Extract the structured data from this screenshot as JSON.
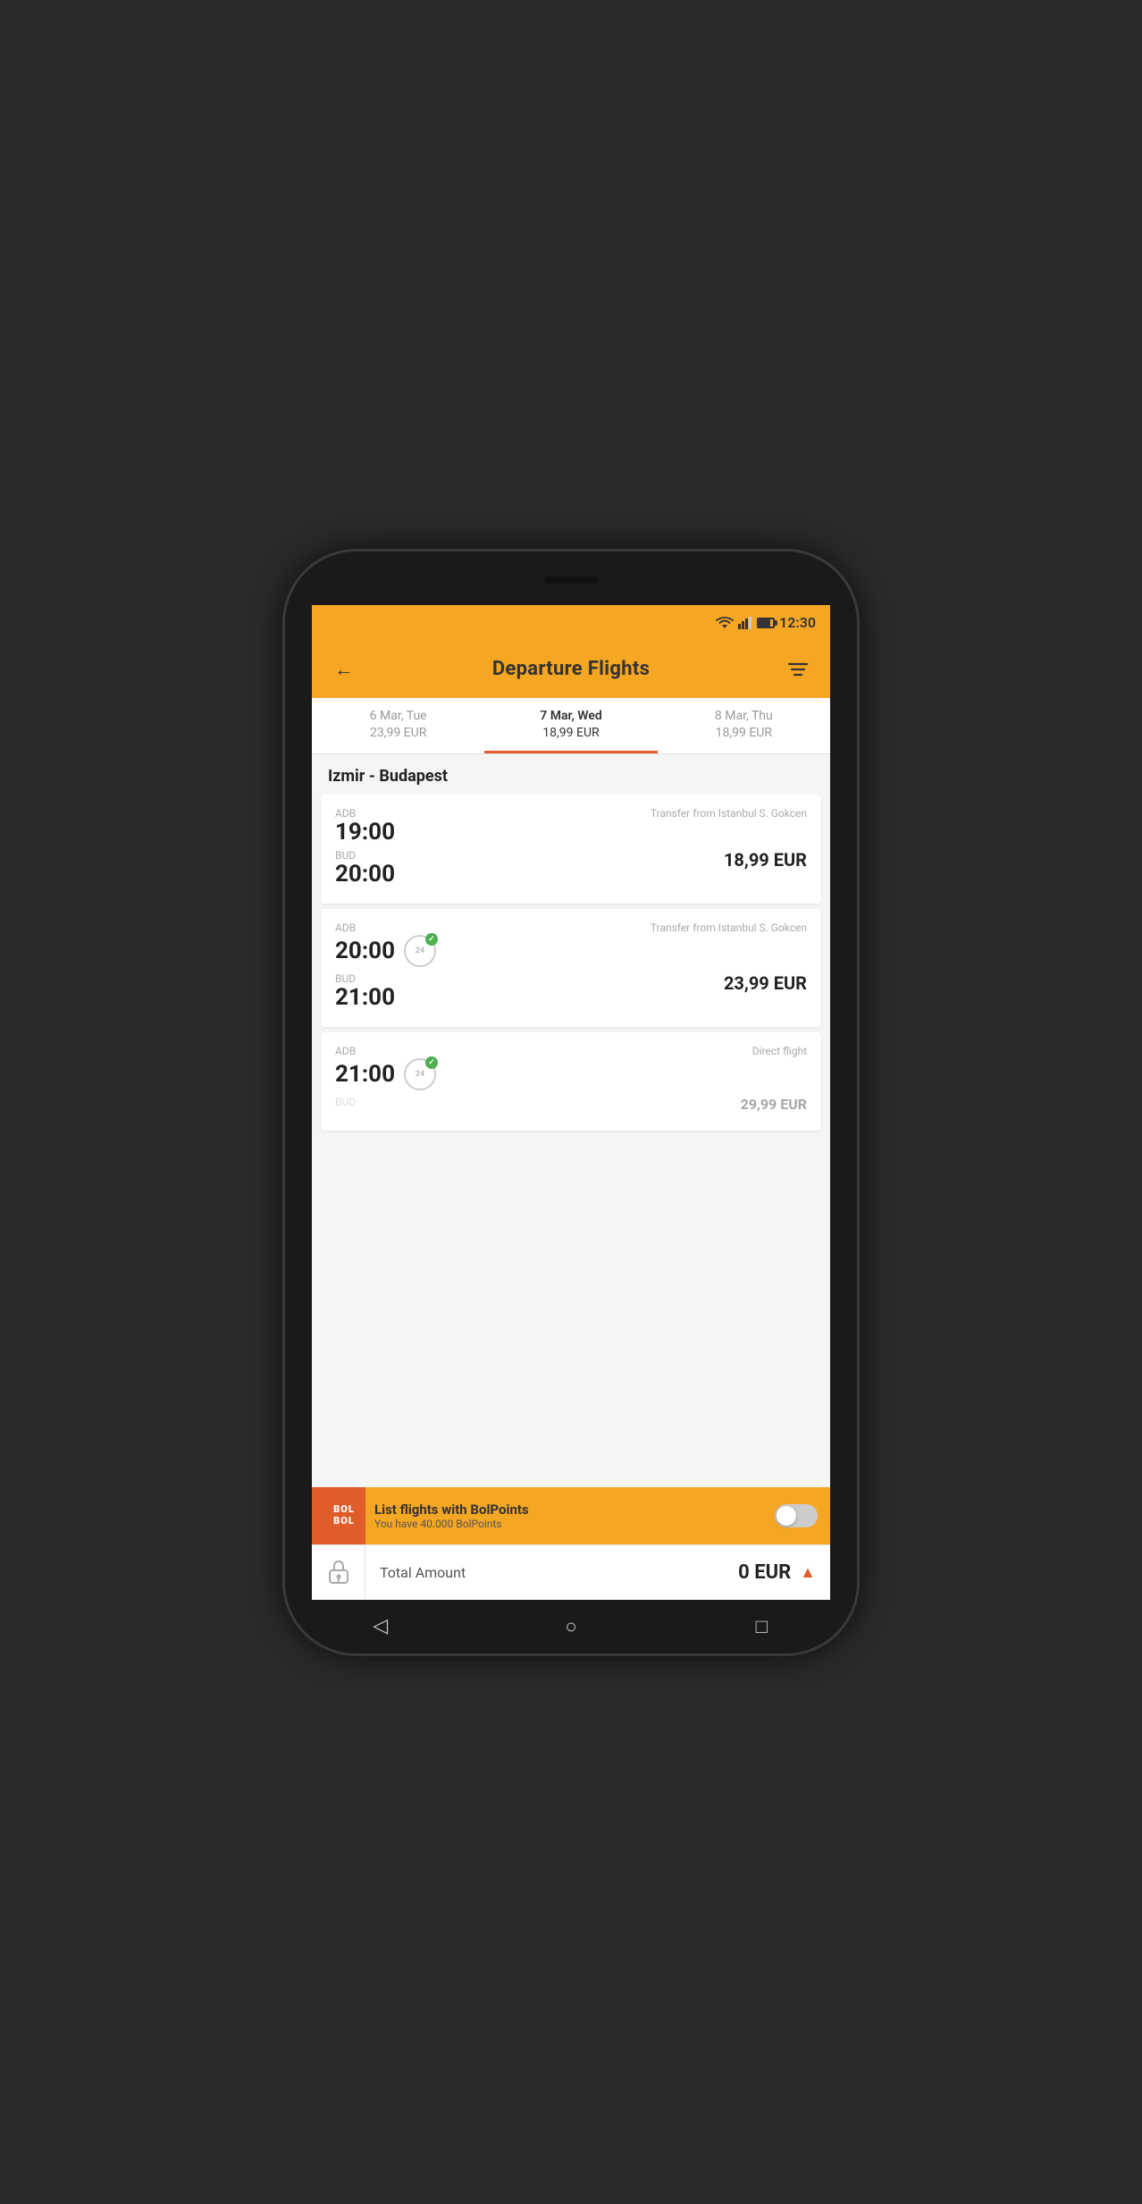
{
  "statusBar": {
    "time": "12:30"
  },
  "header": {
    "title": "Departure Flights",
    "backLabel": "←",
    "filterLabel": "≡"
  },
  "dateTabs": [
    {
      "id": "tab1",
      "date": "6 Mar, Tue",
      "price": "23,99 EUR",
      "active": false
    },
    {
      "id": "tab2",
      "date": "7 Mar, Wed",
      "price": "18,99 EUR",
      "active": true
    },
    {
      "id": "tab3",
      "date": "8 Mar, Thu",
      "price": "18,99 EUR",
      "active": false
    }
  ],
  "routeLabel": "Izmir - Budapest",
  "flights": [
    {
      "id": "f1",
      "depCode": "ADB",
      "depTime": "19:00",
      "arrCode": "BUD",
      "arrTime": "20:00",
      "note": "Transfer from Istanbul S. Gokcen",
      "price": "18,99 EUR",
      "has24Badge": false,
      "directFlight": false
    },
    {
      "id": "f2",
      "depCode": "ADB",
      "depTime": "20:00",
      "arrCode": "BUD",
      "arrTime": "21:00",
      "note": "Transfer from Istanbul S. Gokcen",
      "price": "23,99 EUR",
      "has24Badge": true,
      "directFlight": false
    },
    {
      "id": "f3",
      "depCode": "ADB",
      "depTime": "21:00",
      "arrCode": "BUD",
      "arrTime": "",
      "note": "Direct flight",
      "price": "29,99 EUR",
      "has24Badge": true,
      "directFlight": true,
      "partiallyVisible": true
    }
  ],
  "bolpoints": {
    "logoLine1": "BOL",
    "logoLine2": "BOL",
    "title": "List flights with BolPoints",
    "subtitle": "You have 40.000 BolPoints",
    "toggleOn": false
  },
  "totalBar": {
    "label": "Total Amount",
    "value": "0 EUR"
  },
  "navBar": {
    "backIcon": "◁",
    "homeIcon": "○",
    "recentIcon": "□"
  }
}
